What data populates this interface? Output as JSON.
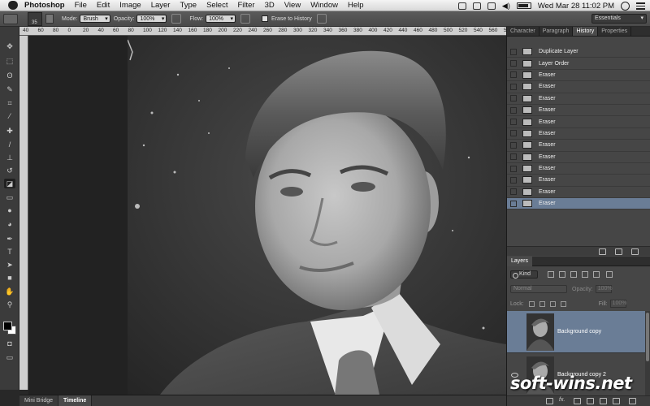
{
  "menubar": {
    "app_name": "Photoshop",
    "items": [
      "File",
      "Edit",
      "Image",
      "Layer",
      "Type",
      "Select",
      "Filter",
      "3D",
      "View",
      "Window",
      "Help"
    ],
    "datetime": "Wed Mar 28  11:02 PM"
  },
  "options": {
    "brush_size": "35",
    "mode_label": "Mode:",
    "mode_value": "Brush",
    "opacity_label": "Opacity:",
    "opacity_value": "100%",
    "flow_label": "Flow:",
    "flow_value": "100%",
    "erase_history_label": "Erase to History",
    "workspace": "Essentials"
  },
  "ruler": {
    "ticks": [
      "40",
      "60",
      "80",
      "0",
      "20",
      "40",
      "60",
      "80",
      "100",
      "120",
      "140",
      "160",
      "180",
      "200",
      "220",
      "240",
      "260",
      "280",
      "300",
      "320",
      "340",
      "360",
      "380",
      "400",
      "420",
      "440",
      "460",
      "480",
      "500",
      "520",
      "540",
      "560",
      "580"
    ]
  },
  "panels": {
    "tabs": [
      "Character",
      "Paragraph",
      "History",
      "Properties"
    ],
    "active_tab": "History",
    "history": [
      {
        "label": "Duplicate Layer",
        "current": false
      },
      {
        "label": "Layer Order",
        "current": false
      },
      {
        "label": "Eraser",
        "current": false
      },
      {
        "label": "Eraser",
        "current": false
      },
      {
        "label": "Eraser",
        "current": false
      },
      {
        "label": "Eraser",
        "current": false
      },
      {
        "label": "Eraser",
        "current": false
      },
      {
        "label": "Eraser",
        "current": false
      },
      {
        "label": "Eraser",
        "current": false
      },
      {
        "label": "Eraser",
        "current": false
      },
      {
        "label": "Eraser",
        "current": false
      },
      {
        "label": "Eraser",
        "current": false
      },
      {
        "label": "Eraser",
        "current": false
      },
      {
        "label": "Eraser",
        "current": true
      }
    ]
  },
  "layers": {
    "tab": "Layers",
    "kind": "Kind",
    "blend_mode": "Normal",
    "opacity_label": "Opacity:",
    "opacity_value": "100%",
    "lock_label": "Lock:",
    "fill_label": "Fill:",
    "fill_value": "100%",
    "items": [
      {
        "name": "Background copy",
        "selected": true,
        "visible": false
      },
      {
        "name": "Background copy 2",
        "selected": false,
        "visible": true
      }
    ]
  },
  "bottom_tabs": [
    "Mini Bridge",
    "Timeline"
  ],
  "watermark": "soft-wins.net",
  "colors": {
    "selection": "#6a7d96",
    "panel_bg": "#464646"
  }
}
